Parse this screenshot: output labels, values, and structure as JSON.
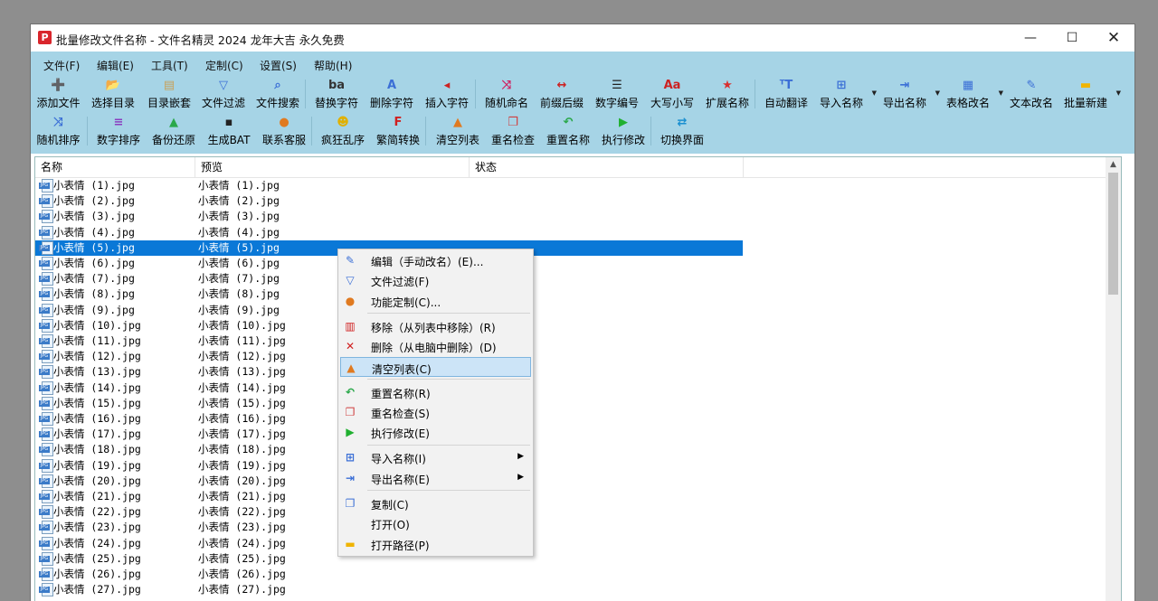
{
  "window": {
    "app_icon": "P",
    "title": "批量修改文件名称 - 文件名精灵 2024 龙年大吉 永久免费",
    "controls": {
      "minimize": "—",
      "maximize": "☐",
      "close": "✕"
    }
  },
  "menu": [
    "文件(F)",
    "编辑(E)",
    "工具(T)",
    "定制(C)",
    "设置(S)",
    "帮助(H)"
  ],
  "toolbar_row1": [
    {
      "label": "添加文件",
      "icon": "add-file-icon",
      "glyph": "➕",
      "color": "#2a7"
    },
    {
      "label": "选择目录",
      "icon": "folder-icon",
      "glyph": "📂",
      "color": "#d9a400"
    },
    {
      "label": "目录嵌套",
      "icon": "nested-folder-icon",
      "glyph": "▤",
      "color": "#c8a05a"
    },
    {
      "label": "文件过滤",
      "icon": "filter-icon",
      "glyph": "▽",
      "color": "#3b6fd6"
    },
    {
      "label": "文件搜索",
      "icon": "search-icon",
      "glyph": "⌕",
      "color": "#3b6fd6"
    },
    {
      "label": "替换字符",
      "icon": "replace-icon",
      "glyph": "ba",
      "color": "#333"
    },
    {
      "label": "删除字符",
      "icon": "delete-char-icon",
      "glyph": "A",
      "color": "#3b6fd6"
    },
    {
      "label": "插入字符",
      "icon": "insert-char-icon",
      "glyph": "◂",
      "color": "#c22"
    },
    {
      "label": "随机命名",
      "icon": "shuffle-icon",
      "glyph": "⤨",
      "color": "#d02060"
    },
    {
      "label": "前缀后缀",
      "icon": "prefix-suffix-icon",
      "glyph": "↔",
      "color": "#c22"
    },
    {
      "label": "数字编号",
      "icon": "numbering-icon",
      "glyph": "☰",
      "color": "#222"
    },
    {
      "label": "大写小写",
      "icon": "case-icon",
      "glyph": "Aa",
      "color": "#c22"
    },
    {
      "label": "扩展名称",
      "icon": "star-icon",
      "glyph": "★",
      "color": "#d83030"
    },
    {
      "label": "自动翻译",
      "icon": "translate-icon",
      "glyph": "ᵀT",
      "color": "#3b6fd6"
    },
    {
      "label": "导入名称",
      "icon": "import-icon",
      "glyph": "⊞",
      "color": "#3b6fd6",
      "dropdown": "▼"
    },
    {
      "label": "导出名称",
      "icon": "export-icon",
      "glyph": "⇥",
      "color": "#3b6fd6",
      "dropdown": "▼"
    },
    {
      "label": "表格改名",
      "icon": "table-icon",
      "glyph": "▦",
      "color": "#3b6fd6",
      "dropdown": "▼"
    },
    {
      "label": "文本改名",
      "icon": "edit-text-icon",
      "glyph": "✎",
      "color": "#3b6fd6"
    },
    {
      "label": "批量新建",
      "icon": "batch-folder-icon",
      "glyph": "▬",
      "color": "#f0b400",
      "dropdown": "▼"
    }
  ],
  "toolbar_row2": [
    {
      "label": "随机排序",
      "icon": "random-sort-icon",
      "glyph": "⤨",
      "color": "#3b6fd6"
    },
    {
      "label": "数字排序",
      "icon": "number-sort-icon",
      "glyph": "≡",
      "color": "#8a3fc0"
    },
    {
      "label": "备份还原",
      "icon": "backup-icon",
      "glyph": "▲",
      "color": "#2aa84a"
    },
    {
      "label": "生成BAT",
      "icon": "bat-icon",
      "glyph": "▪",
      "color": "#222"
    },
    {
      "label": "联系客服",
      "icon": "support-icon",
      "glyph": "●",
      "color": "#e07a20"
    },
    {
      "label": "疯狂乱序",
      "icon": "crazy-shuffle-icon",
      "glyph": "☻",
      "color": "#e0b000"
    },
    {
      "label": "繁简转换",
      "icon": "convert-icon",
      "glyph": "F",
      "color": "#d02020"
    },
    {
      "label": "清空列表",
      "icon": "broom-icon",
      "glyph": "▲",
      "color": "#e07a20"
    },
    {
      "label": "重名检查",
      "icon": "duplicate-check-icon",
      "glyph": "❐",
      "color": "#d04040"
    },
    {
      "label": "重置名称",
      "icon": "reset-icon",
      "glyph": "↶",
      "color": "#2aa84a"
    },
    {
      "label": "执行修改",
      "icon": "run-icon",
      "glyph": "▶",
      "color": "#20b030"
    },
    {
      "label": "切换界面",
      "icon": "switch-ui-icon",
      "glyph": "⇄",
      "color": "#1a8fd0"
    }
  ],
  "list": {
    "columns": [
      "名称",
      "预览",
      "状态"
    ],
    "file_badge": "JPG",
    "selected_index": 4,
    "rows": [
      {
        "name": "小表情 (1).jpg",
        "preview": "小表情 (1).jpg"
      },
      {
        "name": "小表情 (2).jpg",
        "preview": "小表情 (2).jpg"
      },
      {
        "name": "小表情 (3).jpg",
        "preview": "小表情 (3).jpg"
      },
      {
        "name": "小表情 (4).jpg",
        "preview": "小表情 (4).jpg"
      },
      {
        "name": "小表情 (5).jpg",
        "preview": "小表情 (5).jpg"
      },
      {
        "name": "小表情 (6).jpg",
        "preview": "小表情 (6).jpg"
      },
      {
        "name": "小表情 (7).jpg",
        "preview": "小表情 (7).jpg"
      },
      {
        "name": "小表情 (8).jpg",
        "preview": "小表情 (8).jpg"
      },
      {
        "name": "小表情 (9).jpg",
        "preview": "小表情 (9).jpg"
      },
      {
        "name": "小表情 (10).jpg",
        "preview": "小表情 (10).jpg"
      },
      {
        "name": "小表情 (11).jpg",
        "preview": "小表情 (11).jpg"
      },
      {
        "name": "小表情 (12).jpg",
        "preview": "小表情 (12).jpg"
      },
      {
        "name": "小表情 (13).jpg",
        "preview": "小表情 (13).jpg"
      },
      {
        "name": "小表情 (14).jpg",
        "preview": "小表情 (14).jpg"
      },
      {
        "name": "小表情 (15).jpg",
        "preview": "小表情 (15).jpg"
      },
      {
        "name": "小表情 (16).jpg",
        "preview": "小表情 (16).jpg"
      },
      {
        "name": "小表情 (17).jpg",
        "preview": "小表情 (17).jpg"
      },
      {
        "name": "小表情 (18).jpg",
        "preview": "小表情 (18).jpg"
      },
      {
        "name": "小表情 (19).jpg",
        "preview": "小表情 (19).jpg"
      },
      {
        "name": "小表情 (20).jpg",
        "preview": "小表情 (20).jpg"
      },
      {
        "name": "小表情 (21).jpg",
        "preview": "小表情 (21).jpg"
      },
      {
        "name": "小表情 (22).jpg",
        "preview": "小表情 (22).jpg"
      },
      {
        "name": "小表情 (23).jpg",
        "preview": "小表情 (23).jpg"
      },
      {
        "name": "小表情 (24).jpg",
        "preview": "小表情 (24).jpg"
      },
      {
        "name": "小表情 (25).jpg",
        "preview": "小表情 (25).jpg"
      },
      {
        "name": "小表情 (26).jpg",
        "preview": "小表情 (26).jpg"
      },
      {
        "name": "小表情 (27).jpg",
        "preview": "小表情 (27).jpg"
      }
    ]
  },
  "scrollbar": {
    "up_arrow": "▲"
  },
  "context_menu": {
    "highlighted_index": 5,
    "items": [
      {
        "label": "编辑（手动改名）(E)...",
        "icon": "edit-icon",
        "glyph": "✎",
        "color": "#3b6fd6"
      },
      {
        "label": "文件过滤(F)",
        "icon": "filter-icon",
        "glyph": "▽",
        "color": "#3b6fd6"
      },
      {
        "label": "功能定制(C)...",
        "icon": "customize-icon",
        "glyph": "●",
        "color": "#e07a20",
        "sep_after": true
      },
      {
        "label": "移除（从列表中移除）(R)",
        "icon": "trash-icon",
        "glyph": "▥",
        "color": "#d02020"
      },
      {
        "label": "删除（从电脑中删除）(D)",
        "icon": "delete-x-icon",
        "glyph": "✕",
        "color": "#d02020"
      },
      {
        "label": "清空列表(C)",
        "icon": "broom-icon",
        "glyph": "▲",
        "color": "#e07a20",
        "sep_after": true
      },
      {
        "label": "重置名称(R)",
        "icon": "reset-icon",
        "glyph": "↶",
        "color": "#2aa84a"
      },
      {
        "label": "重名检查(S)",
        "icon": "duplicate-check-icon",
        "glyph": "❐",
        "color": "#d04040"
      },
      {
        "label": "执行修改(E)",
        "icon": "run-icon",
        "glyph": "▶",
        "color": "#20b030",
        "sep_after": true
      },
      {
        "label": "导入名称(I)",
        "icon": "import-icon",
        "glyph": "⊞",
        "color": "#3b6fd6",
        "submenu": "▶"
      },
      {
        "label": "导出名称(E)",
        "icon": "export-icon",
        "glyph": "⇥",
        "color": "#3b6fd6",
        "submenu": "▶",
        "sep_after": true
      },
      {
        "label": "复制(C)",
        "icon": "copy-icon",
        "glyph": "❐",
        "color": "#3b6fd6"
      },
      {
        "label": "打开(O)",
        "icon": "",
        "glyph": "",
        "color": "#000"
      },
      {
        "label": "打开路径(P)",
        "icon": "folder-icon",
        "glyph": "▬",
        "color": "#f0b400"
      }
    ]
  }
}
